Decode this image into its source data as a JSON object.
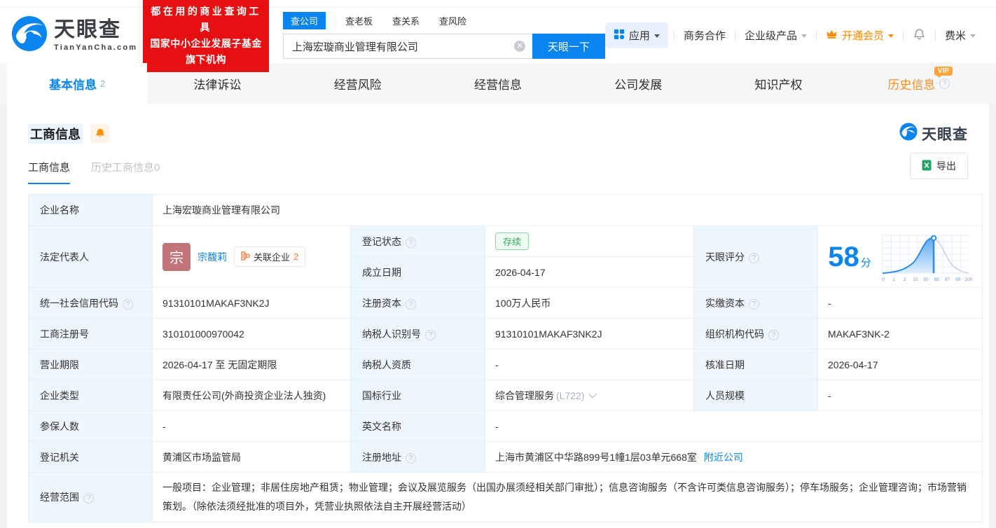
{
  "colors": {
    "accent": "#0a85f0",
    "orange": "#ff8a00",
    "red": "#e60f12",
    "green": "#2fae5e"
  },
  "header": {
    "logo": {
      "brand": "天眼查",
      "domain": "TianYanCha.com"
    },
    "promo": {
      "line1": "都在用的商业查询工具",
      "line2": "国家中小企业发展子基金旗下机构"
    },
    "search": {
      "tabs": [
        {
          "label": "查公司",
          "active": true
        },
        {
          "label": "查老板",
          "active": false
        },
        {
          "label": "查关系",
          "active": false
        },
        {
          "label": "查风险",
          "active": false
        }
      ],
      "value": "上海宏璇商业管理有限公司",
      "button": "天眼一下"
    },
    "menu": {
      "apps": "应用",
      "cooperation": "商务合作",
      "enterprise": "企业级产品",
      "vip": "开通会员",
      "username": "费米"
    }
  },
  "nav_tabs": [
    {
      "label": "基本信息",
      "count": "2",
      "active": true
    },
    {
      "label": "法律诉讼"
    },
    {
      "label": "经营风险"
    },
    {
      "label": "经营信息"
    },
    {
      "label": "公司发展"
    },
    {
      "label": "知识产权"
    },
    {
      "label": "历史信息",
      "vip": "VIP",
      "help": true
    }
  ],
  "section": {
    "title": "工商信息",
    "watermark": "天眼查",
    "subtabs": [
      {
        "label": "工商信息",
        "active": true
      },
      {
        "label": "历史工商信息0",
        "active": false
      }
    ],
    "export_label": "导出"
  },
  "table": {
    "rows": [
      [
        {
          "k": "label",
          "t": "企业名称"
        },
        {
          "k": "text",
          "t": "上海宏璇商业管理有限公司",
          "span": 5
        }
      ],
      [
        {
          "k": "label",
          "t": "法定代表人",
          "rows": 2
        },
        {
          "k": "person",
          "rows": 2,
          "avatar": "宗",
          "name": "宗馥莉",
          "badge_label": "关联企业",
          "badge_count": "2"
        },
        {
          "k": "label",
          "t": "登记状态",
          "help": true
        },
        {
          "k": "status",
          "t": "存续"
        },
        {
          "k": "label",
          "t": "天眼评分",
          "help": true,
          "rows": 2
        },
        {
          "k": "score",
          "rows": 2
        }
      ],
      [
        {
          "k": "label",
          "t": "成立日期"
        },
        {
          "k": "text",
          "t": "2026-04-17"
        }
      ],
      [
        {
          "k": "label",
          "t": "统一社会信用代码",
          "help": true
        },
        {
          "k": "text",
          "t": "91310101MAKAF3NK2J"
        },
        {
          "k": "label",
          "t": "注册资本",
          "help": true
        },
        {
          "k": "text",
          "t": "100万人民币"
        },
        {
          "k": "label",
          "t": "实缴资本",
          "help": true
        },
        {
          "k": "text",
          "t": "-"
        }
      ],
      [
        {
          "k": "label",
          "t": "工商注册号"
        },
        {
          "k": "text",
          "t": "310101000970042"
        },
        {
          "k": "label",
          "t": "纳税人识别号",
          "help": true
        },
        {
          "k": "text",
          "t": "91310101MAKAF3NK2J"
        },
        {
          "k": "label",
          "t": "组织机构代码",
          "help": true
        },
        {
          "k": "text",
          "t": "MAKAF3NK-2"
        }
      ],
      [
        {
          "k": "label",
          "t": "营业期限"
        },
        {
          "k": "text",
          "t": "2026-04-17 至 无固定期限"
        },
        {
          "k": "label",
          "t": "纳税人资质"
        },
        {
          "k": "text",
          "t": "-"
        },
        {
          "k": "label",
          "t": "核准日期"
        },
        {
          "k": "text",
          "t": "2026-04-17"
        }
      ],
      [
        {
          "k": "label",
          "t": "企业类型"
        },
        {
          "k": "text",
          "t": "有限责任公司(外商投资企业法人独资)"
        },
        {
          "k": "label",
          "t": "国标行业"
        },
        {
          "k": "industry",
          "t": "综合管理服务",
          "code": "(L722)"
        },
        {
          "k": "label",
          "t": "人员规模"
        },
        {
          "k": "text",
          "t": "-"
        }
      ],
      [
        {
          "k": "label",
          "t": "参保人数"
        },
        {
          "k": "text",
          "t": "-"
        },
        {
          "k": "label",
          "t": "英文名称"
        },
        {
          "k": "text",
          "t": "-",
          "span": 3
        }
      ],
      [
        {
          "k": "label",
          "t": "登记机关"
        },
        {
          "k": "text",
          "t": "黄浦区市场监管局"
        },
        {
          "k": "label",
          "t": "注册地址",
          "help": true
        },
        {
          "k": "address",
          "t": "上海市黄浦区中华路899号1幢1层03单元668室",
          "link": "附近公司",
          "span": 3
        }
      ],
      [
        {
          "k": "label",
          "t": "经营范围",
          "help": true
        },
        {
          "k": "scope",
          "t": "一般项目：企业管理；非居住房地产租赁；物业管理；会议及展览服务（出国办展须经相关部门审批）；信息咨询服务（不含许可类信息咨询服务）；停车场服务；企业管理咨询；市场营销策划。（除依法须经批准的项目外，凭营业执照依法自主开展经营活动）",
          "span": 5
        }
      ]
    ]
  },
  "chart_data": {
    "type": "area",
    "title": "天眼评分",
    "score": "58",
    "unit": "分",
    "x_ticks": [
      "0",
      "1",
      "3",
      "15",
      "50",
      "85",
      "97",
      "99",
      "100"
    ],
    "marker_value": 58,
    "legend": "none",
    "grid": true
  }
}
